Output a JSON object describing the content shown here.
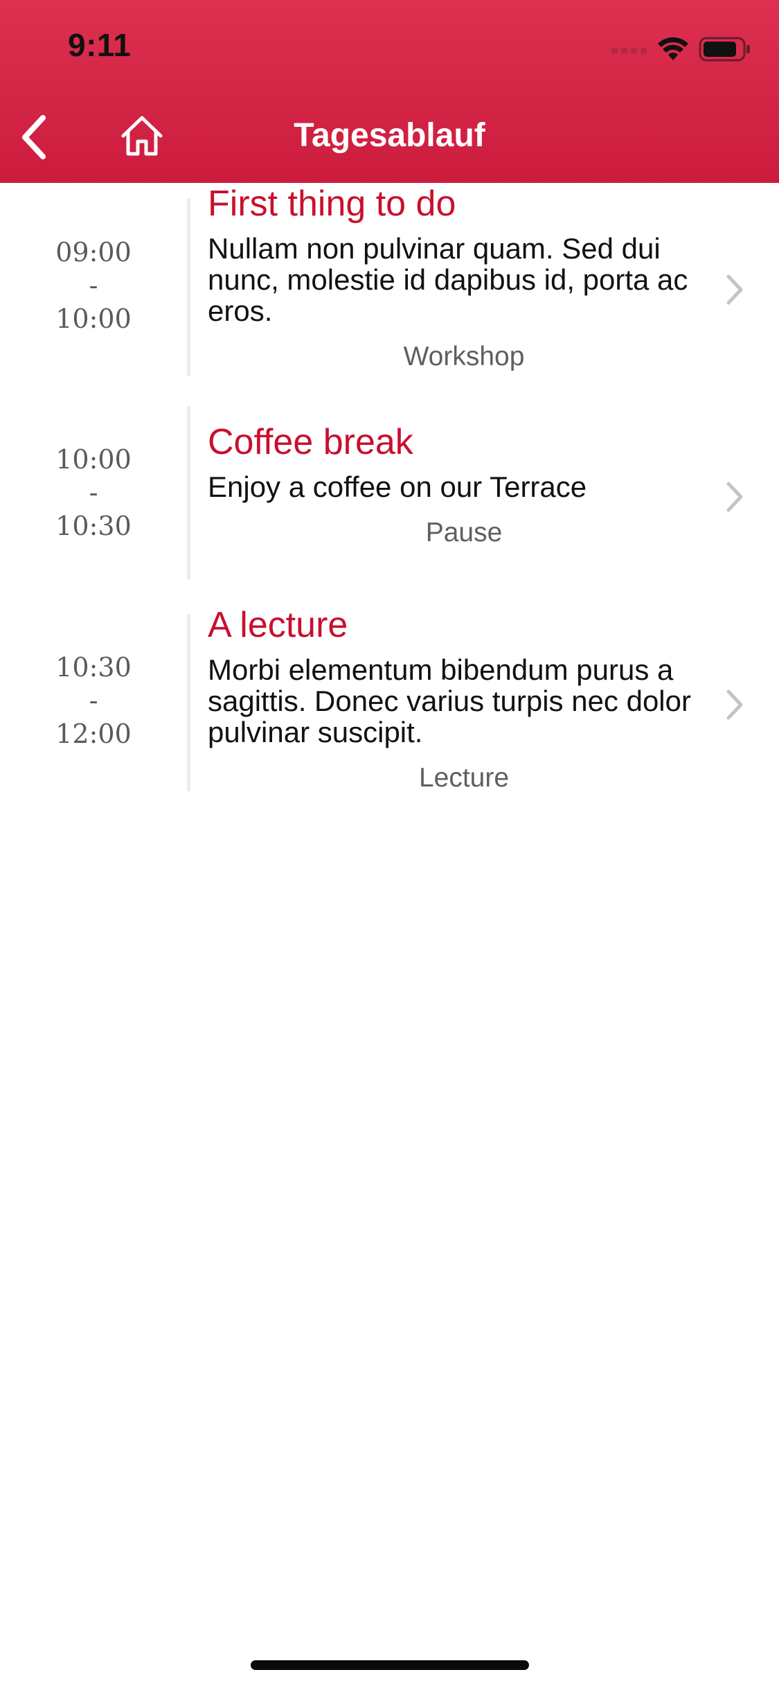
{
  "status_bar": {
    "time": "9:11"
  },
  "nav": {
    "title": "Tagesablauf",
    "back_icon": "chevron-left-icon",
    "home_icon": "home-icon"
  },
  "colors": {
    "header_top": "#dd3050",
    "header_bottom": "#cc1c3e",
    "accent": "#c8102e",
    "time_text": "#5a5a5a",
    "category_text": "#5f5f5f"
  },
  "schedule": {
    "items": [
      {
        "start": "09:00",
        "separator": "-",
        "end": "10:00",
        "title": "First thing to do",
        "description": "Nullam non pulvinar quam. Sed dui nunc, molestie id dapibus id, porta ac eros.",
        "category": "Workshop"
      },
      {
        "start": "10:00",
        "separator": "-",
        "end": "10:30",
        "title": "Coffee break",
        "description": "Enjoy a coffee on our Terrace",
        "category": "Pause"
      },
      {
        "start": "10:30",
        "separator": "-",
        "end": "12:00",
        "title": "A lecture",
        "description": "Morbi elementum bibendum purus a sagittis. Donec varius turpis nec dolor pulvinar suscipit.",
        "category": "Lecture"
      }
    ]
  }
}
